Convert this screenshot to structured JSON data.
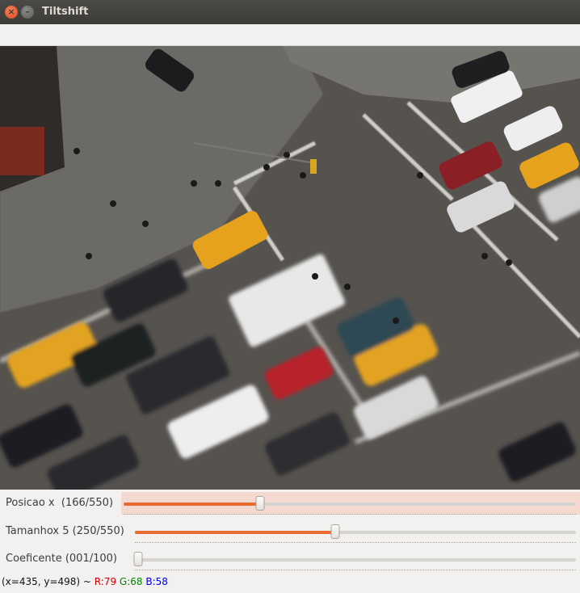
{
  "window": {
    "title": "Tiltshift",
    "close_glyph": "×",
    "min_glyph": "–"
  },
  "trackbars": [
    {
      "label": "Posicao x  (166/550)",
      "value": 166,
      "max": 550
    },
    {
      "label": "Tamanhox 5 (250/550)",
      "value": 250,
      "max": 550
    },
    {
      "label": "Coeficente (001/100)",
      "value": 1,
      "max": 100
    }
  ],
  "status": {
    "coords": "(x=435, y=498) ~ ",
    "r": "R:79",
    "g": "G:68",
    "b": "B:58"
  }
}
